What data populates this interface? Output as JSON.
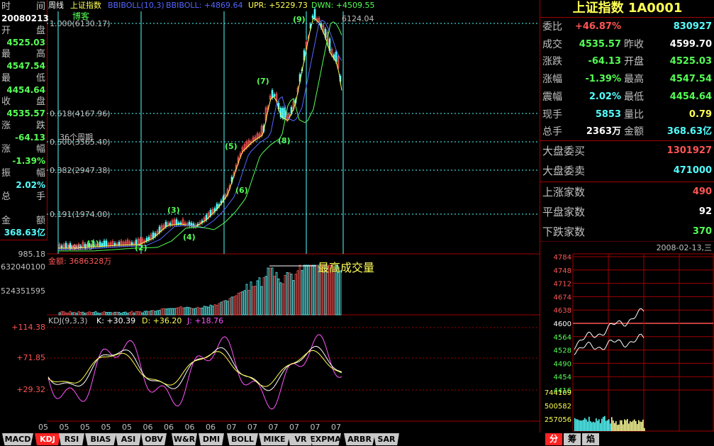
{
  "left_panel": {
    "rows": [
      {
        "name": [
          "时",
          "间"
        ],
        "value": "20080213",
        "color": "#ffffff"
      },
      {
        "name": [
          "开",
          "盘"
        ],
        "value": "4525.03",
        "color": "#55ff55"
      },
      {
        "name": [
          "最",
          "高"
        ],
        "value": "4547.54",
        "color": "#55ff55"
      },
      {
        "name": [
          "最",
          "低"
        ],
        "value": "4454.64",
        "color": "#55ff55"
      },
      {
        "name": [
          "收",
          "盘"
        ],
        "value": "4535.57",
        "color": "#55ff55"
      },
      {
        "name": [
          "涨",
          "跌"
        ],
        "value": "-64.13",
        "color": "#55ff55"
      },
      {
        "name": [
          "涨",
          "幅"
        ],
        "value": "-1.39%",
        "color": "#55ff55"
      },
      {
        "name": [
          "振",
          "幅"
        ],
        "value": "2.02%",
        "color": "#54ffff"
      },
      {
        "name": [
          "总",
          "手"
        ],
        "value": "",
        "color": "#55ff55"
      },
      {
        "name": [
          "金",
          "额"
        ],
        "value": "368.63亿",
        "color": "#54ffff"
      }
    ]
  },
  "main_header": {
    "period": "周线",
    "index_name": "上证指数",
    "boll_label": "BBIBOLL(10,3)",
    "boll_value": "BBIBOLL: +4869.64",
    "upr": "UPR: +5229.73",
    "dwn": "DWN: +4509.55"
  },
  "annotations": {
    "corner_label": "博客",
    "fib_levels": [
      "1.000(6130.17)",
      "0.618(4167.96)",
      "0.500(3565.40)",
      "0.382(2947.38)",
      "0.191(1974.00)"
    ],
    "peak_label": "6124.04",
    "cycle_label": "36个周期",
    "low_label": "998.23",
    "waves": [
      "(1)",
      "(2)",
      "(3)",
      "(4)",
      "(5)",
      "(6)",
      "(7)",
      "(8)",
      "(9)"
    ],
    "max_volume_label": "最高成交量"
  },
  "price_axis": {
    "bottom_label": "985.18"
  },
  "volume_panel": {
    "label": "金额: 3686328万",
    "axis_labels": [
      "632040100",
      "524351595"
    ]
  },
  "kdj_panel": {
    "label": "KDJ(9,3,3)",
    "k": "K: +30.39",
    "d": "D: +36.20",
    "j": "J: +18.76",
    "axis_labels": [
      "+114.38",
      "+71.85",
      "+29.32"
    ]
  },
  "x_axis": {
    "labels": [
      "05",
      "05",
      "05",
      "05",
      "05",
      "06",
      "06",
      "06",
      "06",
      "07",
      "07",
      "07",
      "07",
      "07",
      "07"
    ]
  },
  "bottom_tabs": [
    "MACD",
    "KDJ",
    "RSI",
    "BIAS",
    "ASI",
    "OBV",
    "W&R",
    "DMI",
    "BOLL",
    "MIKE",
    "VR",
    "EXPMA",
    "ARBR",
    "SAR"
  ],
  "active_tab": "KDJ",
  "quote_panel": {
    "title": "上证指数 1A0001",
    "rows": [
      {
        "l1": "委比",
        "v1": "+46.87%",
        "c1": "#ff5555",
        "l2": "",
        "v2": "830927",
        "c2": "#54ffff"
      },
      {
        "l1": "成交",
        "v1": "4535.57",
        "c1": "#55ff55",
        "l2": "昨收",
        "v2": "4599.70",
        "c2": "#ffffff"
      },
      {
        "l1": "涨跌",
        "v1": "-64.13",
        "c1": "#55ff55",
        "l2": "开盘",
        "v2": "4525.03",
        "c2": "#55ff55"
      },
      {
        "l1": "涨幅",
        "v1": "-1.39%",
        "c1": "#55ff55",
        "l2": "最高",
        "v2": "4547.54",
        "c2": "#55ff55"
      },
      {
        "l1": "震幅",
        "v1": "2.02%",
        "c1": "#54ffff",
        "l2": "最低",
        "v2": "4454.64",
        "c2": "#55ff55"
      },
      {
        "l1": "现手",
        "v1": "5853",
        "c1": "#54ffff",
        "l2": "量比",
        "v2": "0.79",
        "c2": "#ffff54"
      },
      {
        "l1": "总手",
        "v1": "2363万",
        "c1": "#ffffff",
        "l2": "金额",
        "v2": "368.63亿",
        "c2": "#54ffff"
      }
    ],
    "order_rows": [
      {
        "label": "大盘委买",
        "value": "1301927",
        "color": "#ff5555"
      },
      {
        "label": "大盘委卖",
        "value": "471000",
        "color": "#54ffff"
      }
    ],
    "breadth_rows": [
      {
        "label": "上涨家数",
        "value": "490",
        "color": "#ff5555"
      },
      {
        "label": "平盘家数",
        "value": "92",
        "color": "#ffffff"
      },
      {
        "label": "下跌家数",
        "value": "370",
        "color": "#55ff55"
      }
    ]
  },
  "intraday": {
    "date": "2008-02-13,三",
    "price_labels": [
      "4784",
      "4748",
      "4712",
      "4674",
      "4638",
      "4600",
      "4564",
      "4528",
      "4490",
      "4454",
      "4416"
    ],
    "volume_labels": [
      "744109",
      "500582",
      "257056"
    ]
  },
  "right_tabs": [
    "分",
    "筹",
    "焰"
  ],
  "colors": {
    "grid_red": "#a00000",
    "candle_up": "#ff5555",
    "candle_down": "#54ffff",
    "ma_yellow": "#ffff54",
    "ma_blue": "#5566ff",
    "ma_green": "#55ff55",
    "kdj_k": "#ffffff",
    "kdj_d": "#ffff54",
    "kdj_j": "#ff55ff"
  }
}
